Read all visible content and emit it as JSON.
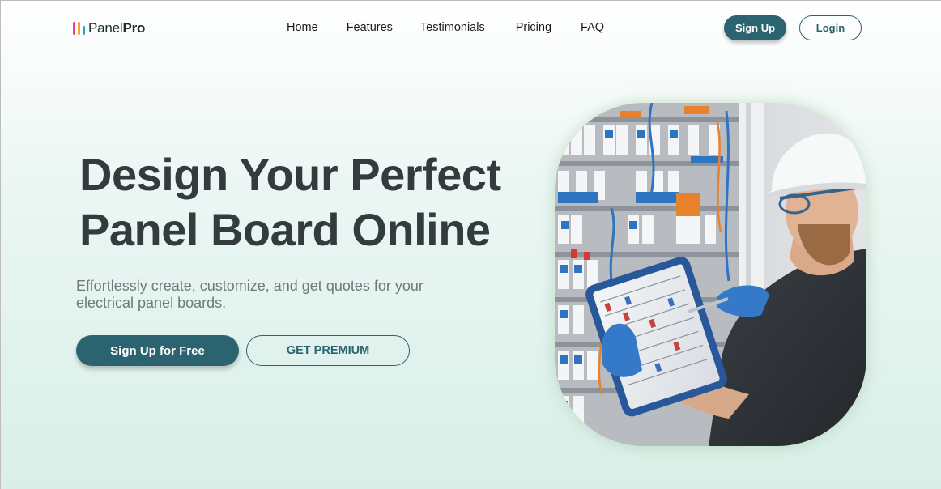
{
  "brand": {
    "name_light": "Panel",
    "name_bold": "Pro",
    "colors": {
      "pink": "#e83e8c",
      "orange": "#f4a62a",
      "blue": "#29a3d8"
    }
  },
  "nav": {
    "items": [
      {
        "label": "Home"
      },
      {
        "label": "Features"
      },
      {
        "label": "Testimonials"
      },
      {
        "label": "Pricing"
      },
      {
        "label": "FAQ"
      }
    ],
    "signup_label": "Sign Up",
    "login_label": "Login"
  },
  "hero": {
    "title_line1": "Design Your Perfect",
    "title_line2": "Panel Board Online",
    "subtitle": "Effortlessly create, customize, and get quotes for your electrical panel boards.",
    "primary_cta": "Sign Up for Free",
    "secondary_cta": "GET PREMIUM",
    "image_icon": "electrician-with-tablet-photo"
  },
  "theme": {
    "accent": "#2b6470",
    "heading": "#333b3e",
    "muted": "#6f787b"
  }
}
